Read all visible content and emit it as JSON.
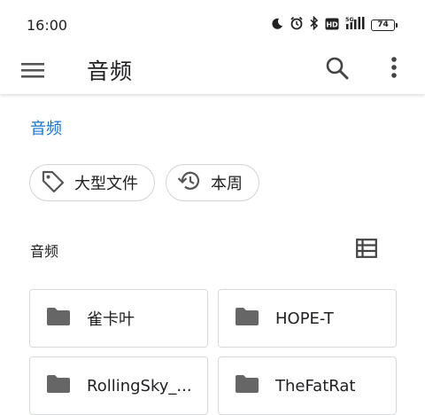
{
  "status_bar": {
    "time": "16:00",
    "icons": [
      "moon-icon",
      "alarm-icon",
      "bluetooth-icon",
      "hd-icon",
      "5g-signal-icon"
    ],
    "battery": "74"
  },
  "app_bar": {
    "title": "音频",
    "icons": {
      "menu": "menu-icon",
      "search": "search-icon",
      "more": "more-vert-icon"
    }
  },
  "breadcrumb": "音频",
  "chips": [
    {
      "label": "大型文件",
      "icon": "tag-icon"
    },
    {
      "label": "本周",
      "icon": "history-icon"
    }
  ],
  "section": {
    "title": "音频",
    "view_toggle_icon": "list-view-icon"
  },
  "folders": [
    {
      "label": "雀卡叶"
    },
    {
      "label": "HOPE-T"
    },
    {
      "label": "RollingSky_..."
    },
    {
      "label": "TheFatRat"
    }
  ],
  "colors": {
    "accent": "#1a73c8",
    "icon": "#5f6368",
    "folder": "#666666"
  }
}
